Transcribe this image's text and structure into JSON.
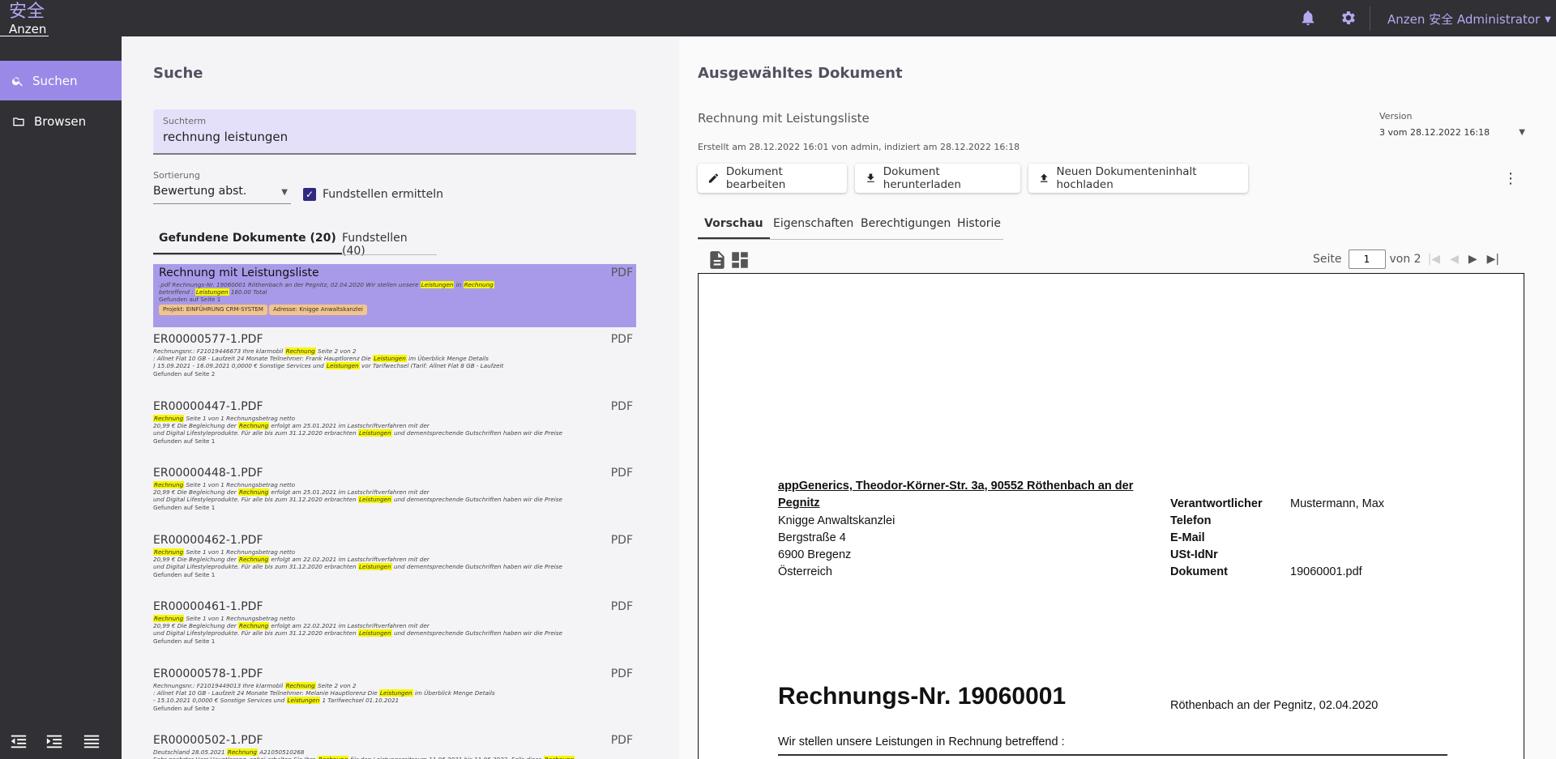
{
  "app": {
    "logo_kanji": "安全",
    "logo_text": "Anzen",
    "user_menu": "Anzen 安全 Administrator"
  },
  "sidebar": {
    "items": [
      {
        "label": "Suchen",
        "icon": "search-icon",
        "active": true
      },
      {
        "label": "Browsen",
        "icon": "folder-icon",
        "active": false
      }
    ]
  },
  "search": {
    "title": "Suche",
    "term_label": "Suchterm",
    "term_value": "rechnung leistungen",
    "sort_label": "Sortierung",
    "sort_value": "Bewertung abst.",
    "checkbox_label": "Fundstellen ermitteln",
    "checkbox_checked": true,
    "tabs": [
      {
        "label": "Gefundene Dokumente (20)",
        "active": true
      },
      {
        "label": "Fundstellen (40)",
        "active": false
      }
    ]
  },
  "results": [
    {
      "title": "Rechnung mit Leistungsliste",
      "type": "PDF",
      "selected": true,
      "snippet": [
        ".pdf Rechnungs-Nr. 19060001 Röthenbach an der Pegnitz, 02.04.2020 Wir stellen unsere <mark>Leistungen</mark> in <mark>Rechnung</mark>",
        "betreffend : <mark>Leistungen</mark> 160.00 Total",
        "Gefunden auf Seite 1"
      ],
      "badges": [
        "Projekt: EINFÜHRUNG CRM-SYSTEM",
        "Adresse: Knigge Anwaltskanzlei"
      ]
    },
    {
      "title": "ER00000577-1.PDF",
      "type": "PDF",
      "snippet": [
        "Rechnungsnr.: F21019446673 Ihre klarmobil <mark>Rechnung</mark> Seite 2 von 2",
        ": Allnet Flat 10 GB - Laufzeit 24 Monate Teilnehmer: Frank Hauptlorenz Die <mark>Leistungen</mark> im Überblick Menge Details",
        ") 15.09.2021 - 16.09.2021 0,0000 € Sonstige Services und <mark>Leistungen</mark> vor Tarifwechsel (Tarif: Allnet Flat 8 GB - Laufzeit",
        "Gefunden auf Seite 2"
      ]
    },
    {
      "title": "ER00000447-1.PDF",
      "type": "PDF",
      "snippet": [
        "<mark>Rechnung</mark> Seite 1 von 1 Rechnungsbetrag netto",
        "20,99 € Die Begleichung der <mark>Rechnung</mark> erfolgt am 25.01.2021 im Lastschriftverfahren mit der",
        "und Digital Lifestyleprodukte. Für alle bis zum 31.12.2020 erbrachten <mark>Leistungen</mark> und dementsprechende Gutschriften haben wir die Preise",
        "Gefunden auf Seite 1"
      ]
    },
    {
      "title": "ER00000448-1.PDF",
      "type": "PDF",
      "snippet": [
        "<mark>Rechnung</mark> Seite 1 von 1 Rechnungsbetrag netto",
        "20,99 € Die Begleichung der <mark>Rechnung</mark> erfolgt am 25.01.2021 im Lastschriftverfahren mit der",
        "und Digital Lifestyleprodukte. Für alle bis zum 31.12.2020 erbrachten <mark>Leistungen</mark> und dementsprechende Gutschriften haben wir die Preise",
        "Gefunden auf Seite 1"
      ]
    },
    {
      "title": "ER00000462-1.PDF",
      "type": "PDF",
      "snippet": [
        "<mark>Rechnung</mark> Seite 1 von 1 Rechnungsbetrag netto",
        "20,99 € Die Begleichung der <mark>Rechnung</mark> erfolgt am 22.02.2021 im Lastschriftverfahren mit der",
        "und Digital Lifestyleprodukte. Für alle bis zum 31.12.2020 erbrachten <mark>Leistungen</mark> und dementsprechende Gutschriften haben wir die Preise",
        "Gefunden auf Seite 1"
      ]
    },
    {
      "title": "ER00000461-1.PDF",
      "type": "PDF",
      "snippet": [
        "<mark>Rechnung</mark> Seite 1 von 1 Rechnungsbetrag netto",
        "20,99 € Die Begleichung der <mark>Rechnung</mark> erfolgt am 22.02.2021 im Lastschriftverfahren mit der",
        "und Digital Lifestyleprodukte. Für alle bis zum 31.12.2020 erbrachten <mark>Leistungen</mark> und dementsprechende Gutschriften haben wir die Preise",
        "Gefunden auf Seite 1"
      ]
    },
    {
      "title": "ER00000578-1.PDF",
      "type": "PDF",
      "snippet": [
        "Rechnungsnr.: F21019449013 Ihre klarmobil <mark>Rechnung</mark> Seite 2 von 2",
        ": Allnet Flat 10 GB - Laufzeit 24 Monate Teilnehmer: Melanie Hauptlorenz Die <mark>Leistungen</mark> im Überblick Menge Details",
        "- 15.10.2021 0,0000 € Sonstige Services und <mark>Leistungen</mark> 1 Tarifwechsel 01.10.2021",
        "Gefunden auf Seite 2"
      ]
    },
    {
      "title": "ER00000502-1.PDF",
      "type": "PDF",
      "snippet": [
        "Deutschland 28.05.2021 <mark>Rechnung</mark> A21050510268",
        "Sehr geehrter Herr Hauptlorenz, anbei erhalten Sie Ihre <mark>Rechnung</mark> für den Leistungszeitraum 11.06.2021 bis 11.06.2022. Falls diese <mark>Rechnung</mark>"
      ]
    }
  ],
  "document": {
    "panel_title": "Ausgewähltes Dokument",
    "name": "Rechnung mit Leistungsliste",
    "meta": "Erstellt am 28.12.2022 16:01 von admin, indiziert am 28.12.2022 16:18",
    "version_label": "Version",
    "version_value": "3 vom 28.12.2022 16:18",
    "actions": [
      {
        "label": "Dokument bearbeiten",
        "icon": "pencil-icon"
      },
      {
        "label": "Dokument herunterladen",
        "icon": "download-icon"
      },
      {
        "label": "Neuen Dokumenteninhalt hochladen",
        "icon": "upload-icon"
      }
    ],
    "tabs": [
      {
        "label": "Vorschau",
        "active": true
      },
      {
        "label": "Eigenschaften",
        "active": false
      },
      {
        "label": "Berechtigungen",
        "active": false
      },
      {
        "label": "Historie",
        "active": false
      }
    ],
    "pager": {
      "page_label": "Seite",
      "current_page": "1",
      "total_label": "von 2"
    }
  },
  "preview": {
    "sender": "appGenerics, Theodor-Körner-Str. 3a, 90552 Röthenbach an der Pegnitz",
    "address_lines": [
      "Knigge Anwaltskanzlei",
      "Bergstraße 4",
      "6900 Bregenz",
      "Österreich"
    ],
    "info": [
      {
        "key": "Verantwortlicher",
        "value": "Mustermann, Max"
      },
      {
        "key": "Telefon",
        "value": ""
      },
      {
        "key": "E-Mail",
        "value": ""
      },
      {
        "key": "USt-IdNr",
        "value": ""
      },
      {
        "key": "Dokument",
        "value": "19060001.pdf"
      }
    ],
    "invoice_title": "Rechnungs-Nr. 19060001",
    "invoice_place_date": "Röthenbach an der Pegnitz, 02.04.2020",
    "intro": "Wir stellen unsere Leistungen in Rechnung betreffend :"
  },
  "colors": {
    "topbar": "#303035",
    "accent": "#9a89e6",
    "selected_row": "#a99ae9",
    "search_field": "#e5e0fa",
    "highlight": "#f6f600",
    "badge": "#f3c48b"
  }
}
